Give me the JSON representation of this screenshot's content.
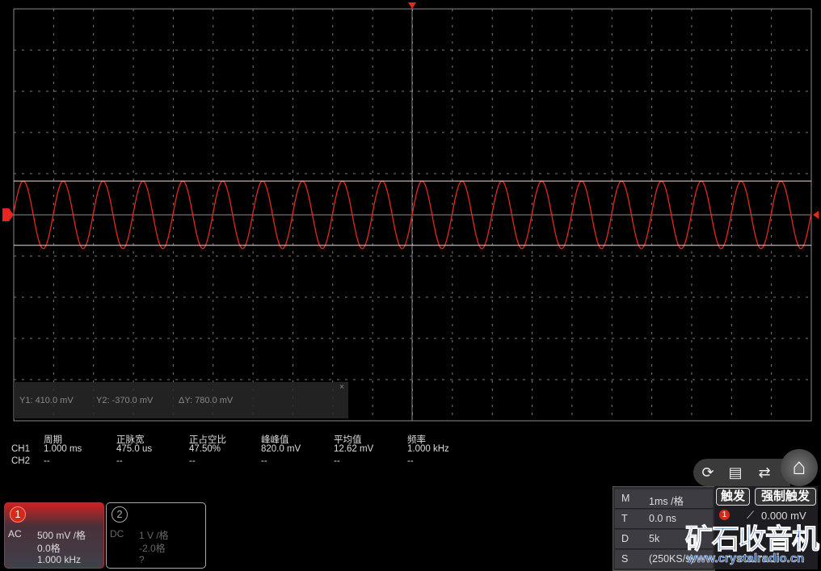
{
  "colors": {
    "ch1": "#e8261e",
    "grid": "#8a8a8a",
    "cursor": "#f0d8d0"
  },
  "waveform": {
    "channel": "CH1",
    "shape": "sine",
    "cycles_on_screen": 20,
    "peak_to_peak_div": 1.64,
    "offset_div": 0
  },
  "cursors": {
    "y1": "Y1: 410.0 mV",
    "y2": "Y2: -370.0 mV",
    "dy": "ΔY: 780.0 mV",
    "close": "×",
    "y1_div": 0.82,
    "y2_div": -0.74
  },
  "measurements": {
    "headers": [
      "周期",
      "正脉宽",
      "正占空比",
      "峰峰值",
      "平均值",
      "频率"
    ],
    "rows": [
      {
        "label": "CH1",
        "values": [
          "1.000 ms",
          "475.0 us",
          "47.50%",
          "820.0 mV",
          "12.62 mV",
          "1.000 kHz"
        ]
      },
      {
        "label": "CH2",
        "values": [
          "--",
          "--",
          "--",
          "--",
          "--",
          "--"
        ]
      }
    ]
  },
  "ch1": {
    "num": "1",
    "coupling": "AC",
    "scale": "500 mV /格",
    "offset": "0.0格",
    "freq": "1.000 kHz"
  },
  "ch2": {
    "num": "2",
    "coupling": "DC",
    "scale": "1 V /格",
    "offset": "-2.0格",
    "freq": "?"
  },
  "toolbar": {
    "icons": [
      "auto-set-icon",
      "save-icon",
      "switch-window-icon",
      "home-icon"
    ]
  },
  "timebase": {
    "m_label": "M",
    "m": "1ms /格",
    "t_label": "T",
    "t": "0.0 ns",
    "d_label": "D",
    "d": "5k",
    "s_label": "S",
    "s": "(250KS/s)"
  },
  "trigger": {
    "trigger_btn": "触发",
    "force_btn": "强制触发",
    "source": "1",
    "level": "0.000 mV"
  },
  "watermark": {
    "cn": "矿石收音机",
    "url": "www.crystalradio.cn"
  }
}
